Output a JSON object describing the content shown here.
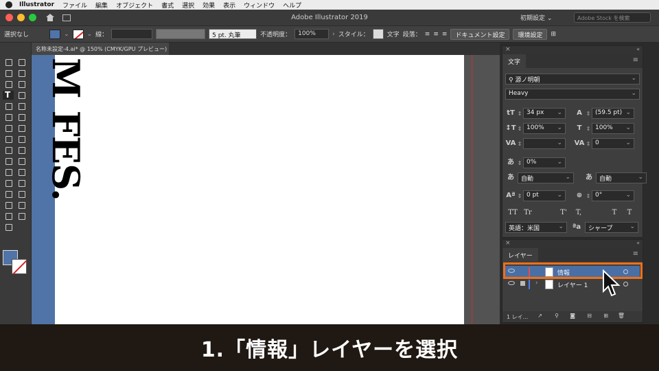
{
  "menubar": {
    "app": "Illustrator",
    "items": [
      "ファイル",
      "編集",
      "オブジェクト",
      "書式",
      "選択",
      "効果",
      "表示",
      "ウィンドウ",
      "ヘルプ"
    ]
  },
  "titlebar": {
    "title": "Adobe Illustrator 2019",
    "workspace": "初期設定 ⌄",
    "stock_placeholder": "Adobe Stock を検索"
  },
  "controlbar": {
    "selection": "選択なし",
    "stroke_label": "線：",
    "brush": "5 pt. 丸筆",
    "opacity_label": "不透明度：",
    "opacity": "100%",
    "style_label": "スタイル：",
    "char_label": "文字",
    "para_label": "段落：",
    "doc_settings": "ドキュメント設定",
    "prefs": "環境設定"
  },
  "document": {
    "tab": "名称未設定-4.ai* @ 150% (CMYK/GPU プレビュー)",
    "art_text": "M FES."
  },
  "character_panel": {
    "tab": "文字",
    "font_family": "源ノ明朝",
    "font_style": "Heavy",
    "font_size": "34 px",
    "leading": "(59.5 pt)",
    "vertical_scale": "100%",
    "horizontal_scale": "100%",
    "kerning": "",
    "tracking": "0",
    "tsume": "0%",
    "aki_left": "自動",
    "aki_right": "自動",
    "baseline_shift": "0 pt",
    "rotation": "0°",
    "language": "英語：米国",
    "antialias": "シャープ",
    "typo_buttons": [
      "TT",
      "Tr",
      "T'",
      "T,",
      "T",
      "T"
    ]
  },
  "layers_panel": {
    "tab": "レイヤー",
    "layers": [
      {
        "name": "情報",
        "selected": true
      },
      {
        "name": "レイヤー 1",
        "selected": false
      }
    ],
    "footer": "1 レイ..."
  },
  "caption": "1.「情報」レイヤーを選択",
  "colors": {
    "fill": "#5073a8",
    "highlight": "#f07018",
    "layer_selected": "#4a6fa5"
  }
}
